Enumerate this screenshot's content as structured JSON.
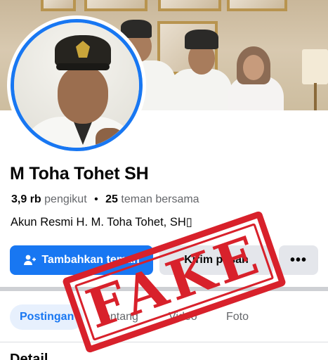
{
  "profile": {
    "name": "M Toha Tohet SH",
    "followers_count": "3,9 rb",
    "followers_label": "pengikut",
    "separator": "•",
    "mutual_count": "25",
    "mutual_label": "teman bersama",
    "bio": "Akun Resmi H. M. Toha Tohet, SH▯"
  },
  "actions": {
    "add_friend": "Tambahkan teman",
    "message": "Kirim pesan",
    "more": "•••"
  },
  "tabs": [
    "Postingan",
    "Tentang",
    "Video",
    "Foto"
  ],
  "section_title": "Detail",
  "stamp": {
    "text": "FAKE",
    "color": "#d8212b"
  },
  "colors": {
    "accent": "#1877f2",
    "button_gray": "#e4e6eb",
    "muted_text": "#65676b"
  },
  "icons": {
    "add_friend": "person-plus-icon",
    "more": "ellipsis-icon"
  }
}
